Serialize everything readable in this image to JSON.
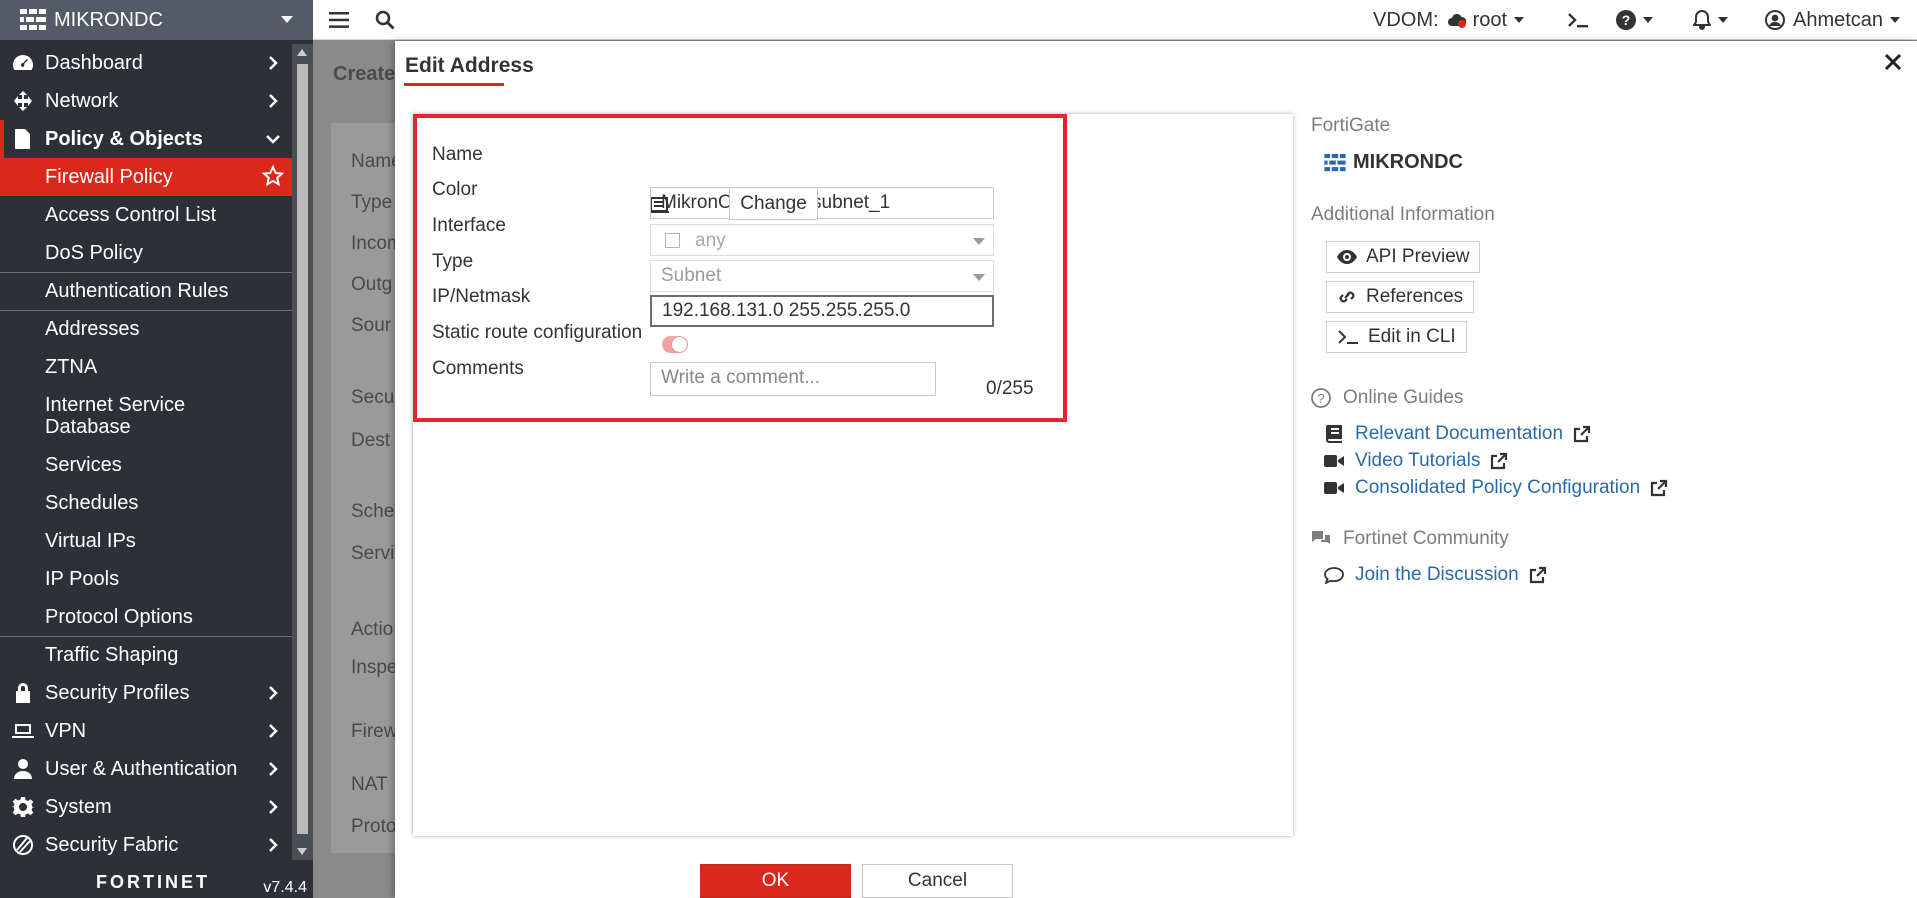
{
  "sidebar": {
    "brand": "MIKRONDC",
    "items": [
      {
        "label": "Dashboard"
      },
      {
        "label": "Network"
      },
      {
        "label": "Policy & Objects"
      },
      {
        "label": "Firewall Policy"
      },
      {
        "label": "Access Control List"
      },
      {
        "label": "DoS Policy"
      },
      {
        "label": "Authentication Rules"
      },
      {
        "label": "Addresses"
      },
      {
        "label": "ZTNA"
      },
      {
        "label": "Internet Service Database"
      },
      {
        "label": "Services"
      },
      {
        "label": "Schedules"
      },
      {
        "label": "Virtual IPs"
      },
      {
        "label": "IP Pools"
      },
      {
        "label": "Protocol Options"
      },
      {
        "label": "Traffic Shaping"
      },
      {
        "label": "Security Profiles"
      },
      {
        "label": "VPN"
      },
      {
        "label": "User & Authentication"
      },
      {
        "label": "System"
      },
      {
        "label": "Security Fabric"
      }
    ],
    "footer_logo": "FORTINET",
    "version": "v7.4.4"
  },
  "topbar": {
    "vdom_label": "VDOM:",
    "vdom_value": "root",
    "user": "Ahmetcan"
  },
  "background_page": {
    "title": "Create",
    "labels": [
      "Name",
      "Type",
      "Incom",
      "Outg",
      "Sour",
      "Secu",
      "Dest",
      "Sche",
      "Servi",
      "Actio",
      "Inspe",
      "Firew",
      "NAT",
      "Proto"
    ]
  },
  "panel": {
    "title": "Edit Address",
    "form": {
      "name_label": "Name",
      "name_value": "MikronOfis_local_subnet_1",
      "color_label": "Color",
      "color_button": "Change",
      "interface_label": "Interface",
      "interface_value": "any",
      "type_label": "Type",
      "type_value": "Subnet",
      "ipmask_label": "IP/Netmask",
      "ipmask_value": "192.168.131.0 255.255.255.0",
      "static_route_label": "Static route configuration",
      "static_route_enabled": true,
      "comments_label": "Comments",
      "comments_placeholder": "Write a comment...",
      "comments_count": "0/255"
    },
    "ok_label": "OK",
    "cancel_label": "Cancel"
  },
  "info": {
    "fortigate_heading": "FortiGate",
    "fortigate_name": "MIKRONDC",
    "additional_heading": "Additional Information",
    "api_preview": "API Preview",
    "references": "References",
    "edit_cli": "Edit in CLI",
    "guides_heading": "Online Guides",
    "guides": [
      {
        "label": "Relevant Documentation",
        "icon": "book-icon"
      },
      {
        "label": "Video Tutorials",
        "icon": "video-icon"
      },
      {
        "label": "Consolidated Policy Configuration",
        "icon": "video-icon"
      }
    ],
    "community_heading": "Fortinet Community",
    "community_link": "Join the Discussion"
  },
  "colors": {
    "accent_red": "#da291c",
    "sidebar_bg": "#2d3137",
    "link_blue": "#2b6aa8",
    "highlight_border": "#e0262e"
  }
}
